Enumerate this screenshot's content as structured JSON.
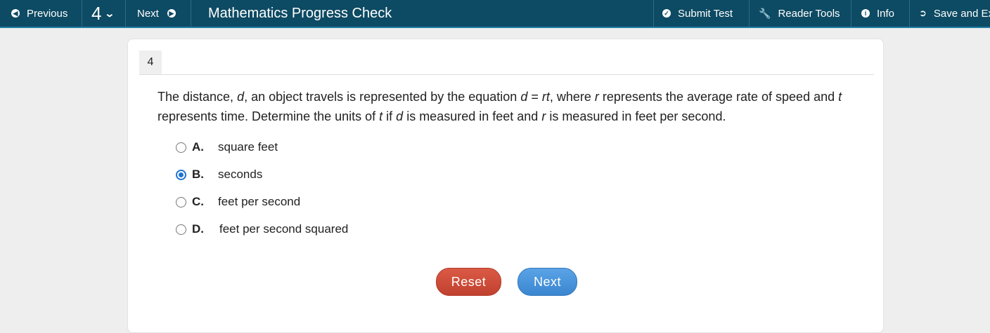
{
  "nav": {
    "previous_label": "Previous",
    "question_number": "4",
    "next_label": "Next",
    "title": "Mathematics Progress Check",
    "submit_label": "Submit Test",
    "reader_tools_label": "Reader Tools",
    "info_label": "Info",
    "save_exit_label": "Save and Exit"
  },
  "question": {
    "number": "4",
    "stem": {
      "p1": "The distance, ",
      "v1": "d",
      "p2": ", an object travels is represented by the equation ",
      "v2": "d",
      "p3": " = ",
      "v3": "rt",
      "p4": ", where ",
      "v4": "r",
      "p5": " represents the average rate of speed and ",
      "v5": "t",
      "p6": " represents time. Determine the units of ",
      "v6": "t",
      "p7": " if ",
      "v7": "d",
      "p8": " is measured in feet and ",
      "v8": "r",
      "p9": " is measured in feet per second."
    },
    "options": [
      {
        "letter": "A.",
        "text": "square feet",
        "selected": false
      },
      {
        "letter": "B.",
        "text": "seconds",
        "selected": true
      },
      {
        "letter": "C.",
        "text": "feet per second",
        "selected": false
      },
      {
        "letter": "D.",
        "text": "feet per second squared",
        "selected": false
      }
    ]
  },
  "actions": {
    "reset_label": "Reset",
    "next_label": "Next"
  },
  "colors": {
    "topbar": "#0d4a63",
    "selected_radio": "#1e73d2",
    "reset_button": "#c9473a",
    "next_button": "#4a94da"
  }
}
